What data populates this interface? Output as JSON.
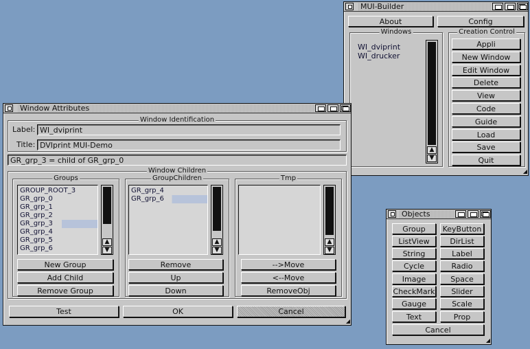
{
  "mui_builder": {
    "title": "MUI-Builder",
    "about_label": "About",
    "config_label": "Config",
    "windows_frame_label": "Windows",
    "windows": [
      "WI_dviprint",
      "WI_drucker"
    ],
    "creation_frame_label": "Creation Control",
    "creation_buttons": [
      "Appli",
      "New Window",
      "Edit Window",
      "Delete",
      "View",
      "Code",
      "Guide",
      "Load",
      "Save",
      "Quit"
    ]
  },
  "window_attributes": {
    "title": "Window Attributes",
    "identification_label": "Window Identification",
    "label_caption": "Label:",
    "label_value": "WI_dviprint",
    "title_caption": "Title:",
    "title_value": "DVIprint MUI-Demo",
    "status_text": "GR_grp_3 = child of GR_grp_0",
    "children_label": "Window Children",
    "groups_label": "Groups",
    "groups": [
      "GROUP_ROOT_3",
      "GR_grp_0",
      "GR_grp_1",
      "GR_grp_2",
      "GR_grp_3",
      "GR_grp_4",
      "GR_grp_5",
      "GR_grp_6"
    ],
    "group_children_label": "GroupChildren",
    "group_children": [
      "GR_grp_4",
      "GR_grp_6"
    ],
    "tmp_label": "Tmp",
    "new_group_label": "New Group",
    "add_child_label": "Add Child",
    "remove_group_label": "Remove Group",
    "remove_label": "Remove",
    "up_label": "Up",
    "down_label": "Down",
    "move_right_label": "-->Move",
    "move_left_label": "<--Move",
    "remove_obj_label": "RemoveObj",
    "test_label": "Test",
    "ok_label": "OK",
    "cancel_label": "Cancel"
  },
  "objects": {
    "title": "Objects",
    "buttons": [
      "Group",
      "KeyButton",
      "ListView",
      "DirList",
      "String",
      "Label",
      "Cycle",
      "Radio",
      "Image",
      "Space",
      "CheckMark",
      "Slider",
      "Gauge",
      "Scale",
      "Text",
      "Prop"
    ],
    "cancel_label": "Cancel"
  },
  "colors": {
    "desktop": "#7c9cc1",
    "window": "#c6c6c6",
    "highlight": "#b7c3da"
  }
}
